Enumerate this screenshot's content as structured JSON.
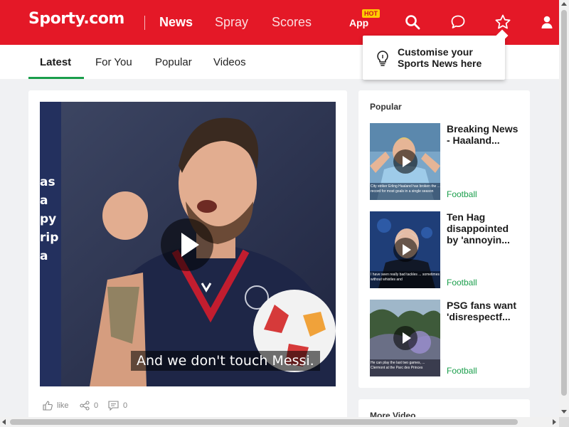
{
  "header": {
    "logo": "Sporty.com",
    "nav": [
      "News",
      "Spray",
      "Scores"
    ],
    "app_label": "App",
    "hot_badge": "HOT",
    "brand_color": "#e41827"
  },
  "tabs": [
    "Latest",
    "For You",
    "Popular",
    "Videos"
  ],
  "tooltip": {
    "text": "Customise your Sports News here"
  },
  "main_video": {
    "caption": "And we don't touch Messi.",
    "side_text": [
      "as",
      "a",
      "py",
      "",
      "rip",
      "a"
    ],
    "actions": {
      "like_label": "like",
      "share_count": "0",
      "comment_count": "0"
    }
  },
  "popular": {
    "title": "Popular",
    "items": [
      {
        "headline": "Breaking News - Haaland...",
        "category": "Football",
        "thumb_caption": "City striker Erling Haaland has broken the ... record for most goals in a single season"
      },
      {
        "headline": "Ten Hag disappointed by 'annoyin...",
        "category": "Football",
        "thumb_caption": "I have seen really bad tackles ... sometimes without whistles and"
      },
      {
        "headline": "PSG fans want 'disrespectf...",
        "category": "Football",
        "thumb_caption": "He can play the last two games, ... Clermont at the Parc des Princes"
      }
    ]
  },
  "more_video": {
    "title": "More Video"
  },
  "accent_color": "#1a9e4b"
}
